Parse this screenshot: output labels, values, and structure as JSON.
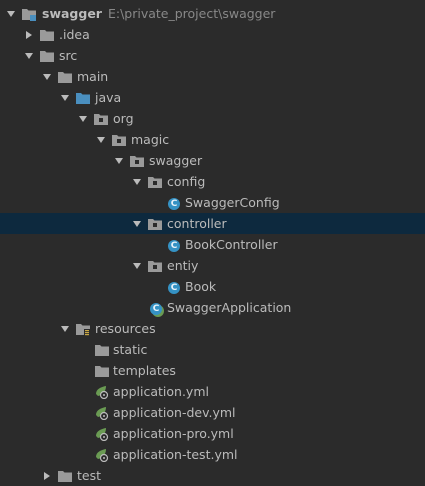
{
  "tree": {
    "root": {
      "name": "swagger",
      "path": "E:\\private_project\\swagger"
    },
    "idea": {
      "name": ".idea"
    },
    "src": {
      "name": "src"
    },
    "main": {
      "name": "main"
    },
    "java": {
      "name": "java"
    },
    "org": {
      "name": "org"
    },
    "magic": {
      "name": "magic"
    },
    "swagger_pkg": {
      "name": "swagger"
    },
    "config": {
      "name": "config"
    },
    "swagger_config": {
      "name": "SwaggerConfig"
    },
    "controller": {
      "name": "controller"
    },
    "book_controller": {
      "name": "BookController"
    },
    "entiy": {
      "name": "entiy"
    },
    "book": {
      "name": "Book"
    },
    "swagger_application": {
      "name": "SwaggerApplication"
    },
    "resources": {
      "name": "resources"
    },
    "static": {
      "name": "static"
    },
    "templates": {
      "name": "templates"
    },
    "app_yml": {
      "name": "application.yml"
    },
    "app_dev_yml": {
      "name": "application-dev.yml"
    },
    "app_pro_yml": {
      "name": "application-pro.yml"
    },
    "app_test_yml": {
      "name": "application-test.yml"
    },
    "test": {
      "name": "test"
    }
  },
  "colors": {
    "background": "#2b2b2b",
    "selection": "#0d293e",
    "text": "#bbbbbb",
    "path_text": "#888888",
    "source_folder": "#4a8fbf",
    "folder": "#9a9a9a",
    "class_badge": "#3592c4",
    "spring_leaf": "#6a9b53"
  }
}
